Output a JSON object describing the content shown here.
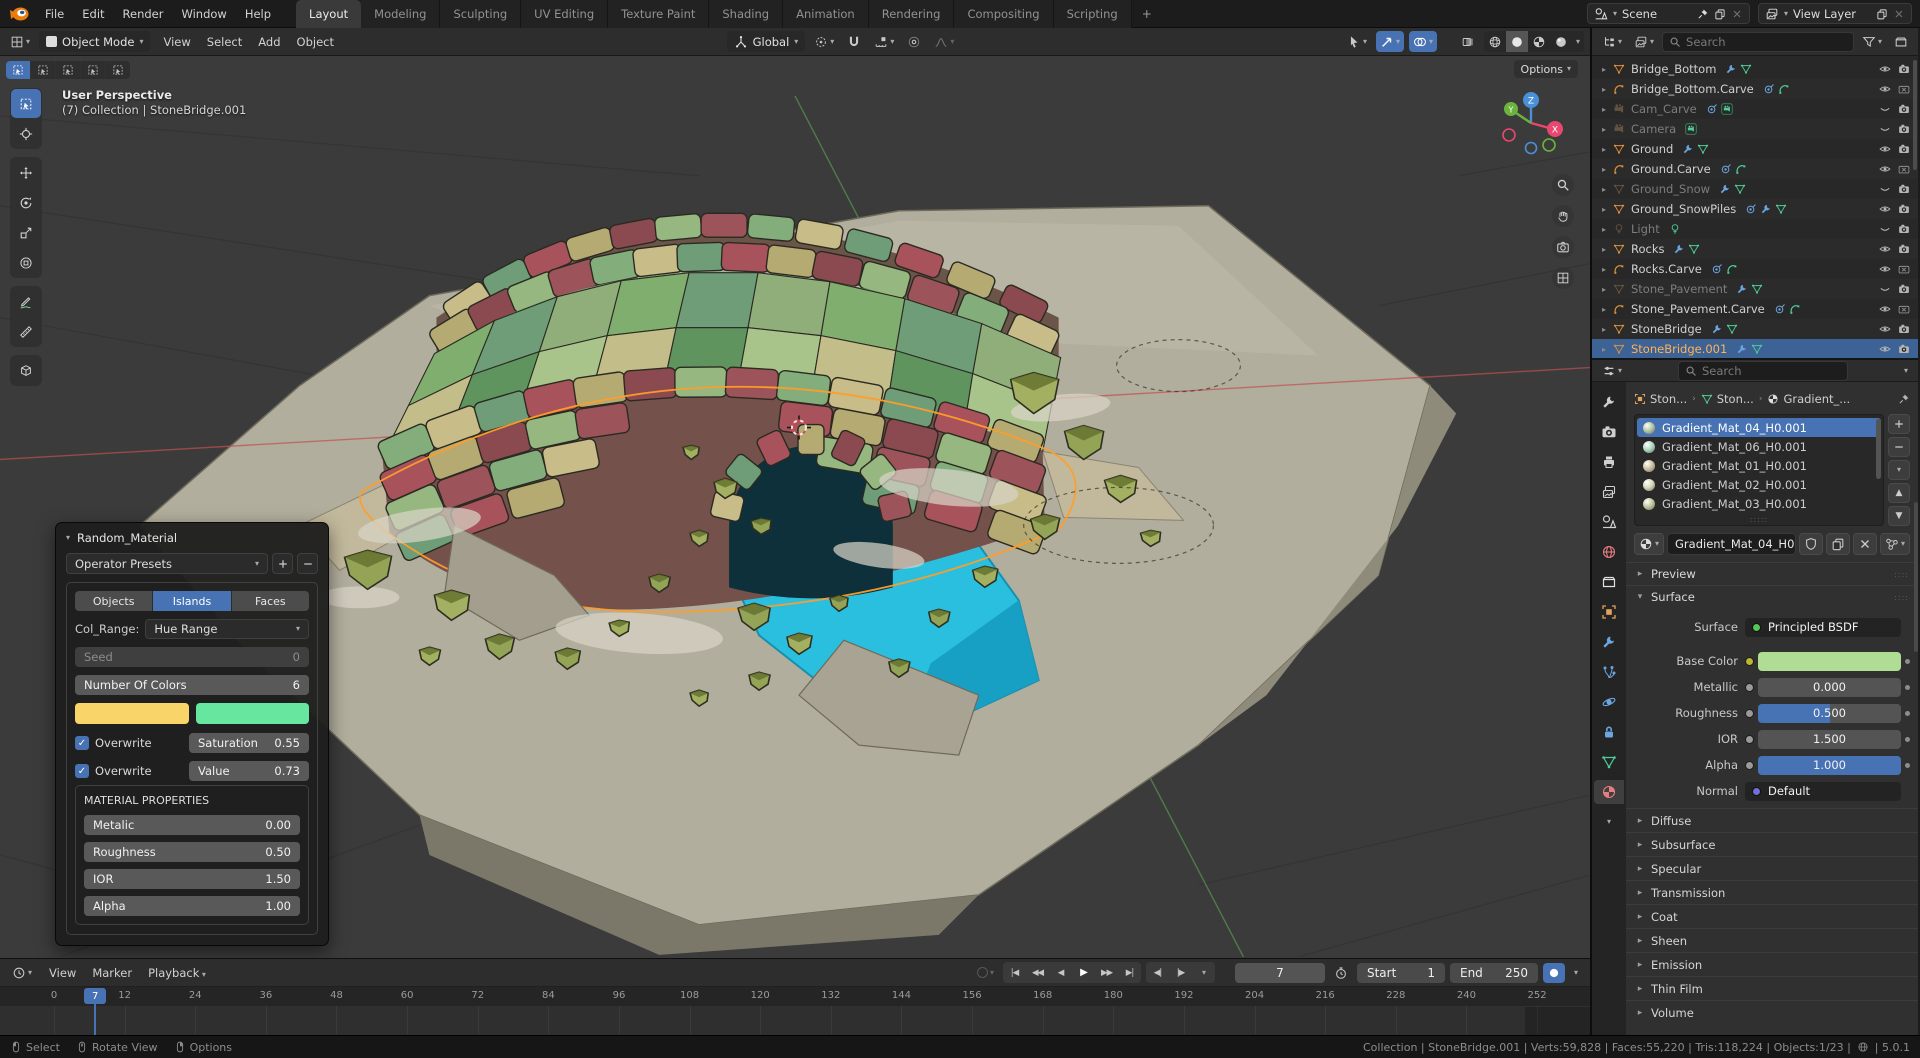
{
  "topbar": {
    "menus": [
      "File",
      "Edit",
      "Render",
      "Window",
      "Help"
    ],
    "workspaces": [
      "Layout",
      "Modeling",
      "Sculpting",
      "UV Editing",
      "Texture Paint",
      "Shading",
      "Animation",
      "Rendering",
      "Compositing",
      "Scripting"
    ],
    "active_workspace": "Layout",
    "add_tab": "+",
    "scene_label": "Scene",
    "view_layer_label": "View Layer"
  },
  "viewport_header": {
    "mode": "Object Mode",
    "menus": [
      "View",
      "Select",
      "Add",
      "Object"
    ],
    "orientation": "Global"
  },
  "viewport": {
    "perspective_label": "User Perspective",
    "context_label": "(7) Collection | StoneBridge.001",
    "options_label": "Options",
    "axes": {
      "x": "X",
      "y": "Y",
      "z": "Z"
    },
    "colors": {
      "background": "#3b3b3b",
      "ground": "#b2ae9d",
      "ground_light": "#c0bcab",
      "ground_dark": "#8f8b7b",
      "water": "#2abfdf",
      "water_dark": "#189fc4",
      "select_outline": "#ff9d2a",
      "stone_palette": [
        "#9c545a",
        "#83ae7c",
        "#c8bc88",
        "#6f9d77",
        "#a8525c",
        "#b5aa72",
        "#8a4a50",
        "#96b77f"
      ],
      "deck_palette": [
        "#7fae6f",
        "#a9c48b",
        "#6f9d77",
        "#c3bd8a",
        "#8fae7a",
        "#5f945f"
      ],
      "rock": "#93a457",
      "rock_alt": "#a4b061",
      "rock_dark": "#66732f",
      "snow": "#d8d4c6"
    }
  },
  "toolbar": {
    "tools": [
      "select-box",
      "cursor",
      "move",
      "rotate",
      "scale",
      "transform",
      "annotate",
      "measure",
      "add-cube"
    ],
    "active_tool": "select-box"
  },
  "operator_panel": {
    "title": "Random_Material",
    "presets": "Operator Presets",
    "tabs": [
      "Objects",
      "Islands",
      "Faces"
    ],
    "active_tab": "Islands",
    "col_range_label": "Col_Range:",
    "col_range_value": "Hue Range",
    "seed": {
      "label": "Seed",
      "value": "0"
    },
    "num_colors": {
      "label": "Number Of Colors",
      "value": "6"
    },
    "swatches": [
      "#f9d469",
      "#67e6a0"
    ],
    "overwrites": [
      {
        "label": "Overwrite",
        "field": "Saturation",
        "value": "0.55"
      },
      {
        "label": "Overwrite",
        "field": "Value",
        "value": "0.73"
      }
    ],
    "material_properties": {
      "title": "MATERIAL PROPERTIES",
      "rows": [
        {
          "label": "Metalic",
          "value": "0.00"
        },
        {
          "label": "Roughness",
          "value": "0.50"
        },
        {
          "label": "IOR",
          "value": "1.50"
        },
        {
          "label": "Alpha",
          "value": "1.00"
        }
      ]
    }
  },
  "outliner": {
    "search_placeholder": "Search",
    "items": [
      {
        "name": "Bridge_Bottom",
        "icon": "mesh",
        "badges": [
          "wrench",
          "tri"
        ],
        "eye": "open",
        "render": "on"
      },
      {
        "name": "Bridge_Bottom.Carve",
        "icon": "curve",
        "badges": [
          "bez",
          "curveg"
        ],
        "eye": "open",
        "render": "off"
      },
      {
        "name": "Cam_Carve",
        "icon": "camera",
        "dim": true,
        "badges": [
          "bez",
          "camg"
        ],
        "eye": "closed",
        "render": "on"
      },
      {
        "name": "Camera",
        "icon": "camera",
        "dim": true,
        "badges": [
          "camg"
        ],
        "eye": "closed",
        "render": "on"
      },
      {
        "name": "Ground",
        "icon": "mesh",
        "badges": [
          "wrench",
          "tri"
        ],
        "eye": "open",
        "render": "on"
      },
      {
        "name": "Ground.Carve",
        "icon": "curve",
        "badges": [
          "bez",
          "curveg"
        ],
        "eye": "open",
        "render": "off"
      },
      {
        "name": "Ground_Snow",
        "icon": "mesh",
        "dim": true,
        "badges": [
          "wrench",
          "tri"
        ],
        "eye": "closed",
        "render": "on"
      },
      {
        "name": "Ground_SnowPiles",
        "icon": "mesh",
        "badges": [
          "bez",
          "wrench",
          "tri"
        ],
        "eye": "open",
        "render": "on"
      },
      {
        "name": "Light",
        "icon": "light",
        "dim": true,
        "badges": [
          "lightg"
        ],
        "eye": "closed",
        "render": "on"
      },
      {
        "name": "Rocks",
        "icon": "mesh",
        "badges": [
          "wrench",
          "tri"
        ],
        "eye": "open",
        "render": "on"
      },
      {
        "name": "Rocks.Carve",
        "icon": "curve",
        "badges": [
          "bez",
          "curveg"
        ],
        "eye": "open",
        "render": "off"
      },
      {
        "name": "Stone_Pavement",
        "icon": "mesh",
        "dim": true,
        "badges": [
          "wrench",
          "tri"
        ],
        "eye": "closed",
        "render": "on"
      },
      {
        "name": "Stone_Pavement.Carve",
        "icon": "curve",
        "badges": [
          "bez",
          "curveg"
        ],
        "eye": "open",
        "render": "off"
      },
      {
        "name": "StoneBridge",
        "icon": "mesh",
        "badges": [
          "wrench",
          "tri"
        ],
        "eye": "open",
        "render": "on"
      },
      {
        "name": "StoneBridge.001",
        "icon": "mesh",
        "selected": true,
        "badges": [
          "wrench",
          "tri"
        ],
        "eye": "open",
        "render": "on"
      }
    ]
  },
  "properties": {
    "search_placeholder": "Search",
    "breadcrumb": [
      {
        "icon": "object",
        "label": "Ston..."
      },
      {
        "icon": "data",
        "label": "Ston..."
      },
      {
        "icon": "material",
        "label": "Gradient_..."
      }
    ],
    "slots": [
      {
        "name": "Gradient_Mat_04_H0.001",
        "selected": true,
        "ball": "#b6cba4"
      },
      {
        "name": "Gradient_Mat_06_H0.001",
        "ball": "#b0d9c2"
      },
      {
        "name": "Gradient_Mat_01_H0.001",
        "ball": "#cfc2a4"
      },
      {
        "name": "Gradient_Mat_02_H0.001",
        "ball": "#d8dab9"
      },
      {
        "name": "Gradient_Mat_03_H0.001",
        "ball": "#c3c99d"
      }
    ],
    "material_name": "Gradient_Mat_04_H0.001",
    "preview_label": "Preview",
    "surface_label": "Surface",
    "surface_rows": [
      {
        "label": "Surface",
        "type": "node",
        "value": "Principled BSDF",
        "socket": "#56c456"
      },
      {
        "label": "Base Color",
        "type": "color",
        "color": "#aedd93",
        "socket": "#b8b82e",
        "dot": true
      },
      {
        "label": "Metallic",
        "type": "slider",
        "value": "0.000",
        "fill": 0,
        "socket": "#9a9a9a",
        "dot": true
      },
      {
        "label": "Roughness",
        "type": "slider",
        "value": "0.500",
        "fill": 50,
        "socket": "#9a9a9a",
        "dot": true
      },
      {
        "label": "IOR",
        "type": "slider",
        "value": "1.500",
        "fill": 0,
        "socket": "#9a9a9a",
        "dot": true
      },
      {
        "label": "Alpha",
        "type": "slider",
        "value": "1.000",
        "fill": 100,
        "socket": "#9a9a9a",
        "dot": true
      },
      {
        "label": "Normal",
        "type": "node",
        "value": "Default",
        "socket": "#7070d8"
      }
    ],
    "collapsed_panels": [
      "Diffuse",
      "Subsurface",
      "Specular",
      "Transmission",
      "Coat",
      "Sheen",
      "Emission",
      "Thin Film",
      "Volume"
    ]
  },
  "timeline": {
    "menus": [
      "View",
      "Marker",
      "Playback"
    ],
    "current_frame": "7",
    "fields": {
      "start_label": "Start",
      "start_value": "1",
      "end_label": "End",
      "end_value": "250"
    },
    "ruler": {
      "start": 0,
      "step": 12,
      "end": 252
    }
  },
  "statusbar": {
    "hints": [
      {
        "button": "left",
        "label": "Select"
      },
      {
        "button": "middle",
        "label": "Rotate View"
      },
      {
        "button": "right",
        "label": "Options"
      }
    ],
    "stats": "Collection | StoneBridge.001 | Verts:59,828 | Faces:55,220 | Tris:118,224 | Objects:1/23 |",
    "version": "| 5.0.1"
  }
}
